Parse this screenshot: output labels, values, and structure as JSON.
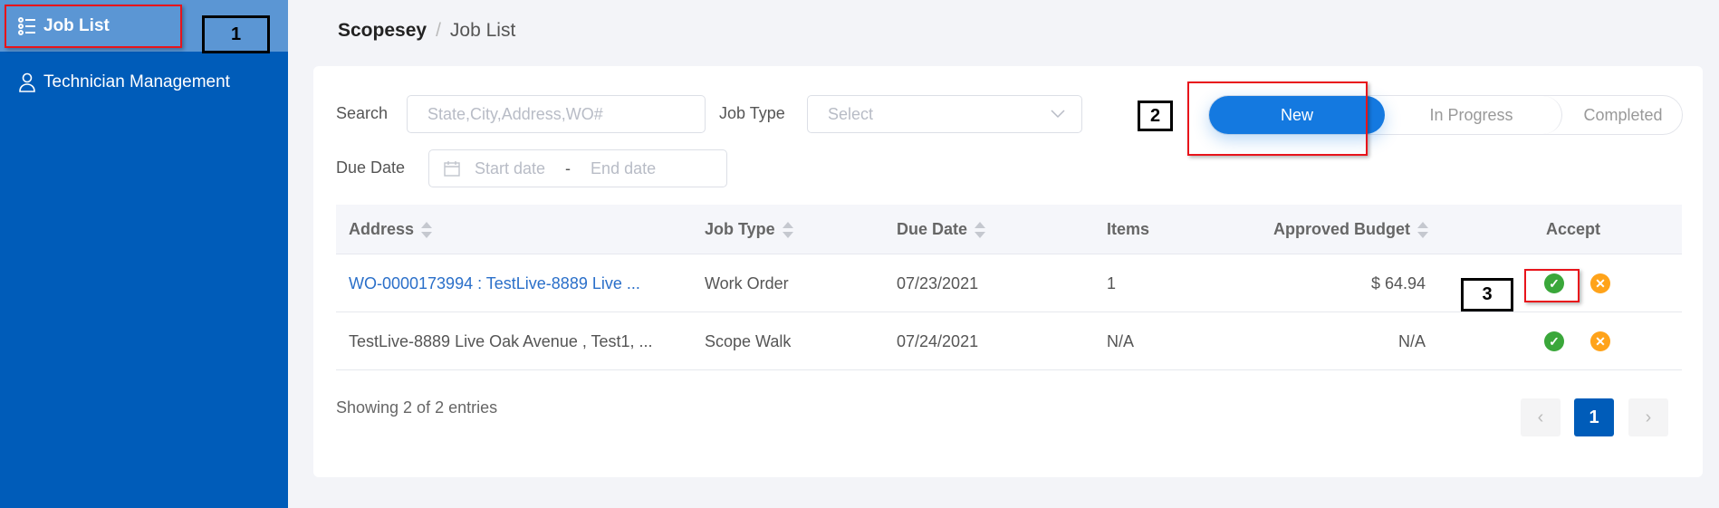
{
  "sidebar": {
    "items": [
      {
        "label": "Job List",
        "icon": "list-icon",
        "active": true
      },
      {
        "label": "Technician Management",
        "icon": "technician-icon"
      }
    ]
  },
  "breadcrumb": {
    "root": "Scopesey",
    "separator": "/",
    "current": "Job List"
  },
  "filters": {
    "search_label": "Search",
    "search_placeholder": "State,City,Address,WO#",
    "job_type_label": "Job Type",
    "job_type_placeholder": "Select",
    "due_date_label": "Due Date",
    "start_placeholder": "Start date",
    "range_sep": "-",
    "end_placeholder": "End date"
  },
  "status_tabs": [
    {
      "label": "New",
      "active": true
    },
    {
      "label": "In Progress"
    },
    {
      "label": "Completed"
    }
  ],
  "table": {
    "columns": [
      "Address",
      "Job Type",
      "Due Date",
      "Items",
      "Approved Budget",
      "Accept"
    ],
    "rows": [
      {
        "address": "WO-0000173994 : TestLive-8889 Live ...",
        "job_type": "Work Order",
        "due_date": "07/23/2021",
        "items": "1",
        "budget": "$ 64.94"
      },
      {
        "address": "TestLive-8889 Live Oak Avenue , Test1, ...",
        "job_type": "Scope Walk",
        "due_date": "07/24/2021",
        "items": "N/A",
        "budget": "N/A"
      }
    ]
  },
  "footer": {
    "showing": "Showing 2 of 2 entries",
    "page": "1",
    "prev": "‹",
    "next": "›"
  },
  "annotations": [
    "1",
    "2",
    "3"
  ],
  "colors": {
    "sidebar": "#005cb9",
    "accent": "#1479e0",
    "accept": "#3aa73a",
    "reject": "#ffa31a",
    "annotation_red": "#e8141b"
  }
}
